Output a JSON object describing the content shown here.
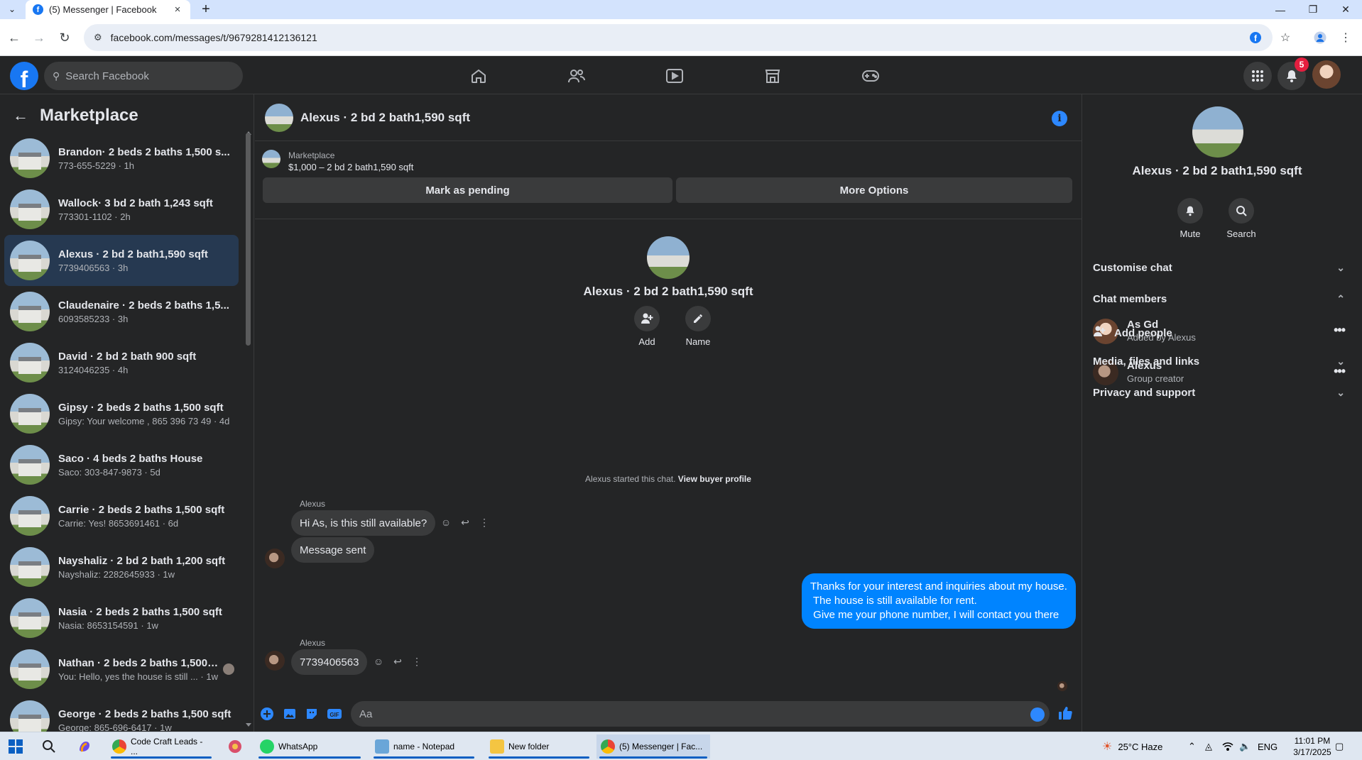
{
  "browser": {
    "tab_title": "(5) Messenger | Facebook",
    "url": "facebook.com/messages/t/9679281412136121"
  },
  "fb": {
    "search_placeholder": "Search Facebook",
    "notif_count": "5"
  },
  "sidebar": {
    "title": "Marketplace",
    "conversations": [
      {
        "title": "Brandon· 2 beds 2 baths 1,500 s...",
        "sub": "773-655-5229 · 1h"
      },
      {
        "title": "Wallock· 3 bd 2 bath 1,243 sqft",
        "sub": "773301-1102 · 2h"
      },
      {
        "title": "Alexus · 2 bd 2 bath1,590 sqft",
        "sub": "7739406563 · 3h"
      },
      {
        "title": "Claudenaire · 2 beds 2 baths 1,5...",
        "sub": "6093585233 · 3h"
      },
      {
        "title": "David · 2 bd 2 bath 900 sqft",
        "sub": "3124046235 · 4h"
      },
      {
        "title": "Gipsy · 2 beds 2 baths 1,500 sqft",
        "sub": "Gipsy: Your welcome , 865 396 73 49 · 4d"
      },
      {
        "title": "Saco · 4 beds 2 baths House",
        "sub": "Saco: 303-847-9873 · 5d"
      },
      {
        "title": "Carrie · 2 beds 2 baths 1,500 sqft",
        "sub": "Carrie: Yes! 8653691461 · 6d"
      },
      {
        "title": "Nayshaliz · 2 bd 2 bath 1,200 sqft",
        "sub": "Nayshaliz: 2282645933 · 1w"
      },
      {
        "title": "Nasia · 2 beds 2 baths 1,500 sqft",
        "sub": "Nasia: 8653154591 · 1w"
      },
      {
        "title": "Nathan · 2 beds 2 baths 1,500 ...",
        "sub": "You: Hello, yes the house is still ... · 1w"
      },
      {
        "title": "George · 2 beds 2 baths 1,500 sqft",
        "sub": "George: 865-696-6417 · 1w"
      }
    ]
  },
  "chat": {
    "title": "Alexus · 2 bd 2 bath1,590 sqft",
    "marketplace_label": "Marketplace",
    "listing": "$1,000 – 2 bd 2 bath1,590 sqft",
    "mark_pending": "Mark as pending",
    "more_options": "More Options",
    "intro_name": "Alexus · 2 bd 2 bath1,590 sqft",
    "add_label": "Add",
    "name_label": "Name",
    "started_text": "Alexus started this chat.",
    "view_buyer": "View buyer profile",
    "messages": [
      {
        "sender": "Alexus",
        "text": "Hi As, is this still available?"
      },
      {
        "text": "Message sent"
      },
      {
        "text": "Thanks for your interest and inquiries about my house.\n The house is still available for rent.\n Give me your phone number, I will contact you there"
      },
      {
        "sender": "Alexus",
        "text": "7739406563"
      }
    ],
    "composer_placeholder": "Aa"
  },
  "rpanel": {
    "name": "Alexus · 2 bd 2 bath1,590 sqft",
    "mute": "Mute",
    "search": "Search",
    "customise": "Customise chat",
    "members_title": "Chat members",
    "members": [
      {
        "name": "As Gd",
        "role": "Added by Alexus"
      },
      {
        "name": "Alexus",
        "role": "Group creator"
      }
    ],
    "add_people": "Add people",
    "media": "Media, files and links",
    "privacy": "Privacy and support"
  },
  "taskbar": {
    "apps": [
      "Code Craft Leads - ...",
      "WhatsApp",
      "name - Notepad",
      "New folder",
      "(5) Messenger | Fac..."
    ],
    "weather": "25°C  Haze",
    "lang": "ENG",
    "time": "11:01 PM",
    "date": "3/17/2025"
  }
}
